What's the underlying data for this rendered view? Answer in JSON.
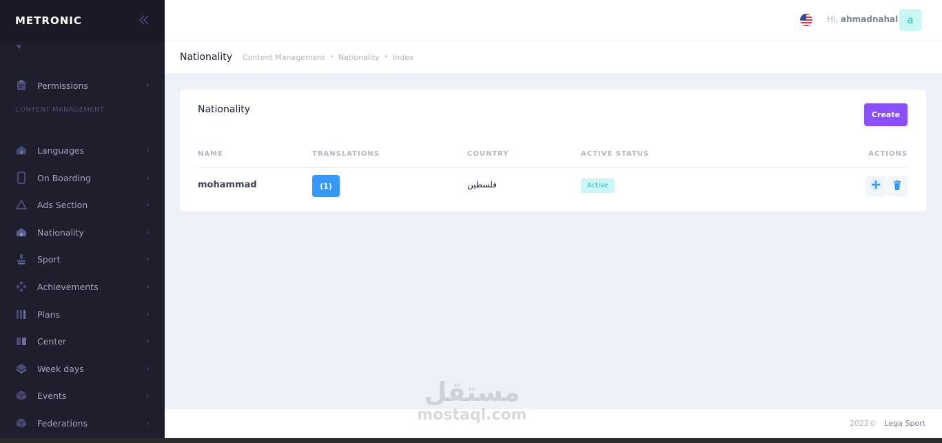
{
  "brand": {
    "logo": "METRONIC",
    "toggle_icon": "chevrons-left-icon"
  },
  "sidebar": {
    "section_title": "CONTENT MANAGEMENT",
    "items": [
      {
        "label": "Permissions",
        "icon": "clipboard-icon"
      },
      {
        "label": "Languages",
        "icon": "home-icon"
      },
      {
        "label": "On Boarding",
        "icon": "phone-icon"
      },
      {
        "label": "Ads Section",
        "icon": "triangle-icon"
      },
      {
        "label": "Nationality",
        "icon": "house-icon"
      },
      {
        "label": "Sport",
        "icon": "stamp-icon"
      },
      {
        "label": "Achievements",
        "icon": "diamond-dots-icon"
      },
      {
        "label": "Plans",
        "icon": "bars-icon"
      },
      {
        "label": "Center",
        "icon": "book-icon"
      },
      {
        "label": "Week days",
        "icon": "layers-icon"
      },
      {
        "label": "Events",
        "icon": "cube-icon"
      },
      {
        "label": "Federations",
        "icon": "cube-icon"
      }
    ]
  },
  "header": {
    "greeting": "Hi,",
    "username": "ahmadnahal",
    "avatar_letter": "a",
    "flag": "us-flag-icon"
  },
  "subheader": {
    "title": "Nationality",
    "breadcrumbs": [
      "Content Management",
      "Nationality",
      "Index"
    ]
  },
  "card": {
    "title": "Nationality",
    "create_label": "Create",
    "columns": [
      "NAME",
      "TRANSLATIONS",
      "COUNTRY",
      "ACTIVE STATUS",
      "ACTIONS"
    ],
    "rows": [
      {
        "name": "mohammad",
        "translations": "(1)",
        "country": "فلسطين",
        "status": "Active"
      }
    ]
  },
  "footer": {
    "year": "2022©",
    "company": "Lega Sport"
  },
  "watermark": {
    "arabic": "مستقل",
    "latin": "mostaql.com"
  },
  "colors": {
    "primary": "#8950fc",
    "info": "#3699ff",
    "success_light": "#c9f7f5",
    "sidebar_bg": "#1e1e2d"
  }
}
